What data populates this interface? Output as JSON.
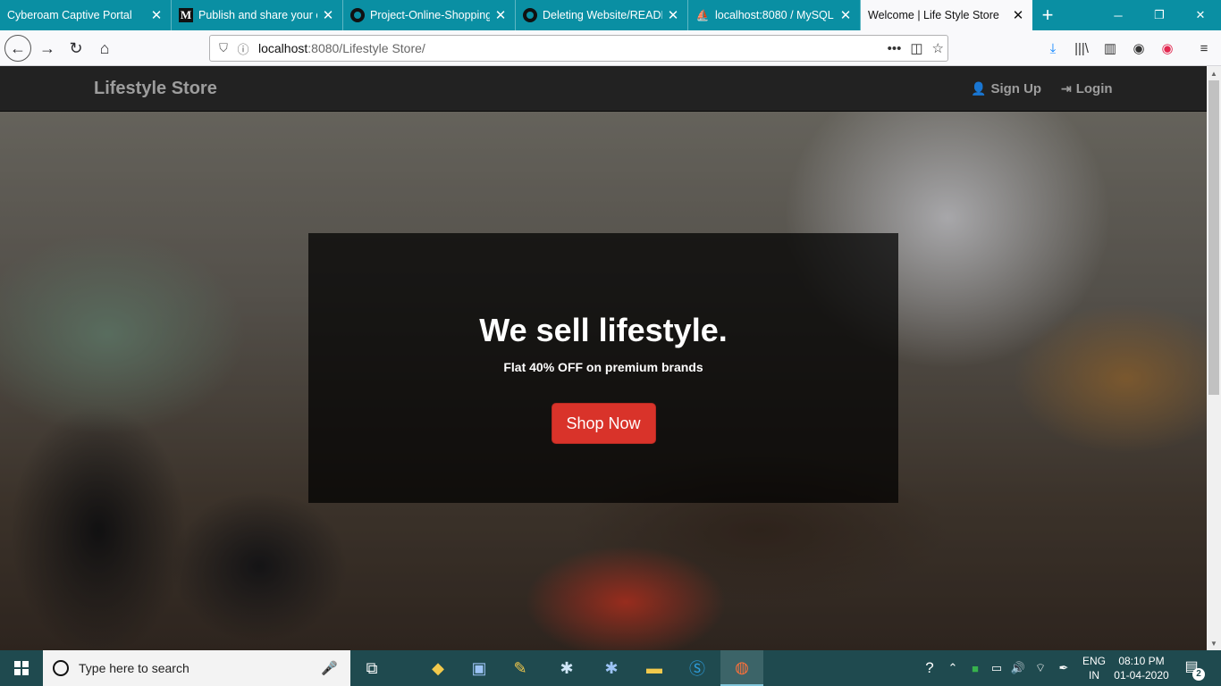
{
  "browser": {
    "tabs": [
      {
        "title": "Cyberoam Captive Portal",
        "icon": "none"
      },
      {
        "title": "Publish and share your o",
        "icon": "medium-icon"
      },
      {
        "title": "Project-Online-Shopping",
        "icon": "github-icon"
      },
      {
        "title": "Deleting Website/READM",
        "icon": "github-icon"
      },
      {
        "title": "localhost:8080 / MySQL /",
        "icon": "phpmyadmin-icon"
      },
      {
        "title": "Welcome | Life Style Store",
        "icon": "none"
      }
    ],
    "url_host": "localhost",
    "url_rest": ":8080/Lifestyle Store/"
  },
  "site": {
    "brand": "Lifestyle Store",
    "nav": {
      "signup": "Sign Up",
      "login": "Login"
    },
    "banner": {
      "headline": "We sell lifestyle.",
      "subtitle": "Flat 40% OFF on premium brands",
      "cta": "Shop Now"
    }
  },
  "taskbar": {
    "search_placeholder": "Type here to search",
    "lang_line1": "ENG",
    "lang_line2": "IN",
    "time": "08:10 PM",
    "date": "01-04-2020",
    "notification_count": "2"
  },
  "colors": {
    "tabstrip": "#0a8fa3",
    "nav_bg": "#222222",
    "cta": "#d9332a",
    "taskbar": "#1f4a4f"
  }
}
